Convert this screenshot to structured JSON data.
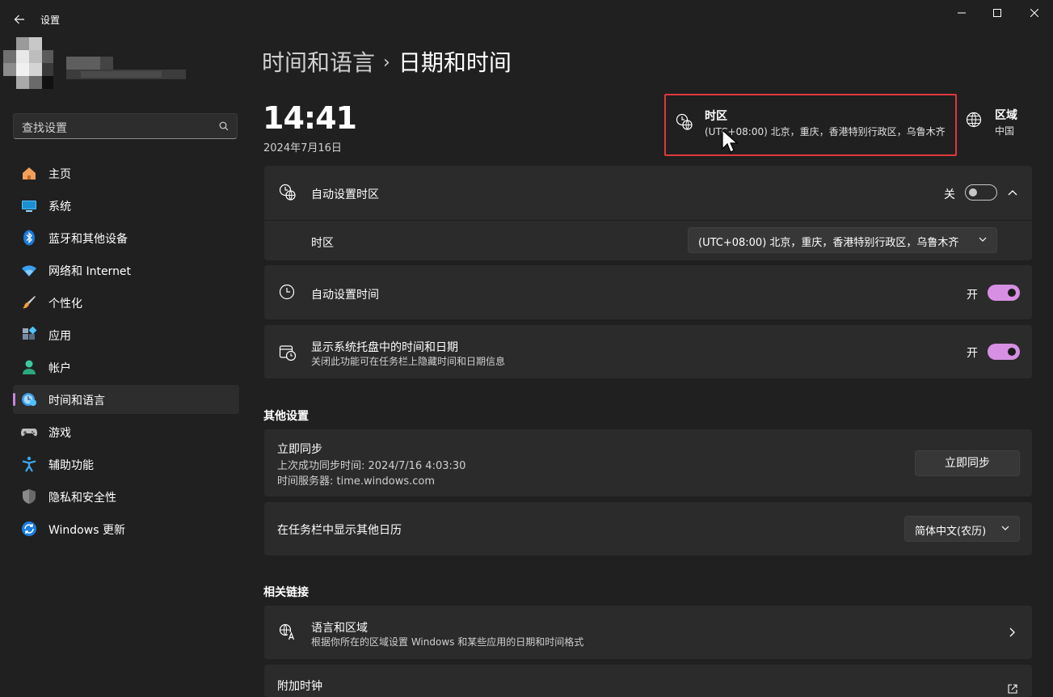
{
  "window": {
    "title": "设置"
  },
  "search": {
    "placeholder": "查找设置"
  },
  "nav": [
    {
      "label": "主页",
      "icon": "home-icon"
    },
    {
      "label": "系统",
      "icon": "system-icon"
    },
    {
      "label": "蓝牙和其他设备",
      "icon": "bluetooth-icon"
    },
    {
      "label": "网络和 Internet",
      "icon": "wifi-icon"
    },
    {
      "label": "个性化",
      "icon": "brush-icon"
    },
    {
      "label": "应用",
      "icon": "apps-icon"
    },
    {
      "label": "帐户",
      "icon": "account-icon"
    },
    {
      "label": "时间和语言",
      "icon": "time-language-icon",
      "active": true
    },
    {
      "label": "游戏",
      "icon": "gamepad-icon"
    },
    {
      "label": "辅助功能",
      "icon": "accessibility-icon"
    },
    {
      "label": "隐私和安全性",
      "icon": "shield-icon"
    },
    {
      "label": "Windows 更新",
      "icon": "update-icon"
    }
  ],
  "breadcrumb": {
    "parent": "时间和语言",
    "separator": "›",
    "current": "日期和时间"
  },
  "clock": {
    "time": "14:41",
    "date": "2024年7月16日"
  },
  "header_timezone": {
    "title": "时区",
    "value": "(UTC+08:00) 北京，重庆，香港特别行政区，乌鲁木齐"
  },
  "header_region": {
    "title": "区域",
    "value": "中国"
  },
  "auto_timezone": {
    "label": "自动设置时区",
    "state_label": "关",
    "on": false
  },
  "timezone_row": {
    "label": "时区",
    "value": "(UTC+08:00) 北京，重庆，香港特别行政区，乌鲁木齐"
  },
  "auto_time": {
    "label": "自动设置时间",
    "state_label": "开",
    "on": true
  },
  "tray": {
    "label": "显示系统托盘中的时间和日期",
    "sub": "关闭此功能可在任务栏上隐藏时间和日期信息",
    "state_label": "开",
    "on": true
  },
  "other_settings": {
    "heading": "其他设置",
    "sync": {
      "title": "立即同步",
      "last_sync": "上次成功同步时间: 2024/7/16 4:03:30",
      "server": "时间服务器: time.windows.com",
      "button": "立即同步"
    },
    "calendar": {
      "label": "在任务栏中显示其他日历",
      "value": "简体中文(农历)"
    }
  },
  "related": {
    "heading": "相关链接",
    "language_region": {
      "title": "语言和区域",
      "sub": "根据你所在的区域设置 Windows 和某些应用的日期和时间格式"
    },
    "extra_clocks": {
      "title": "附加时钟"
    }
  },
  "colors": {
    "accent": "#d78fe3",
    "highlight_border": "#e0383e",
    "background": "#202020",
    "card": "#2b2b2b"
  }
}
